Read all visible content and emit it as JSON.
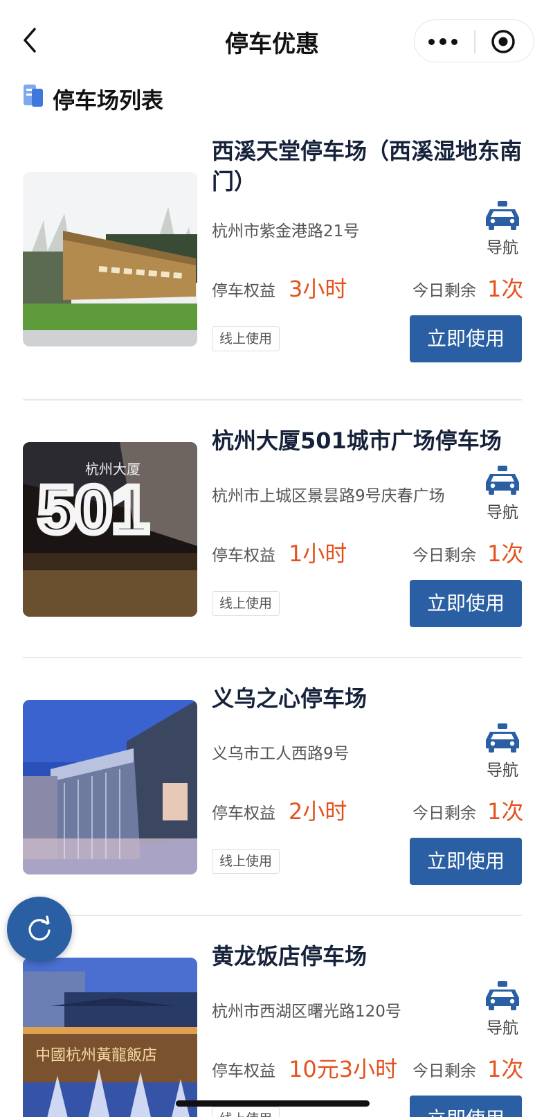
{
  "header": {
    "title": "停车优惠"
  },
  "section": {
    "title": "停车场列表"
  },
  "labels": {
    "benefit": "停车权益",
    "remaining": "今日剩余",
    "navigate": "导航",
    "use_now": "立即使用",
    "online_tag": "线上使用"
  },
  "lots": [
    {
      "name": "西溪天堂停车场（西溪湿地东南门）",
      "address": "杭州市紫金港路21号",
      "benefit": "3小时",
      "remaining": "1次"
    },
    {
      "name": "杭州大厦501城市广场停车场",
      "address": "杭州市上城区景昙路9号庆春广场",
      "benefit": "1小时",
      "remaining": "1次"
    },
    {
      "name": "义乌之心停车场",
      "address": "义乌市工人西路9号",
      "benefit": "2小时",
      "remaining": "1次"
    },
    {
      "name": "黄龙饭店停车场",
      "address": "杭州市西湖区曙光路120号",
      "benefit": "10元3小时",
      "remaining": "1次"
    }
  ],
  "colors": {
    "accent": "#2b5fa3",
    "highlight": "#e5511c"
  },
  "icons": [
    "back-arrow-icon",
    "more-dots-icon",
    "target-close-icon",
    "list-icon",
    "taxi-icon",
    "refresh-icon"
  ]
}
